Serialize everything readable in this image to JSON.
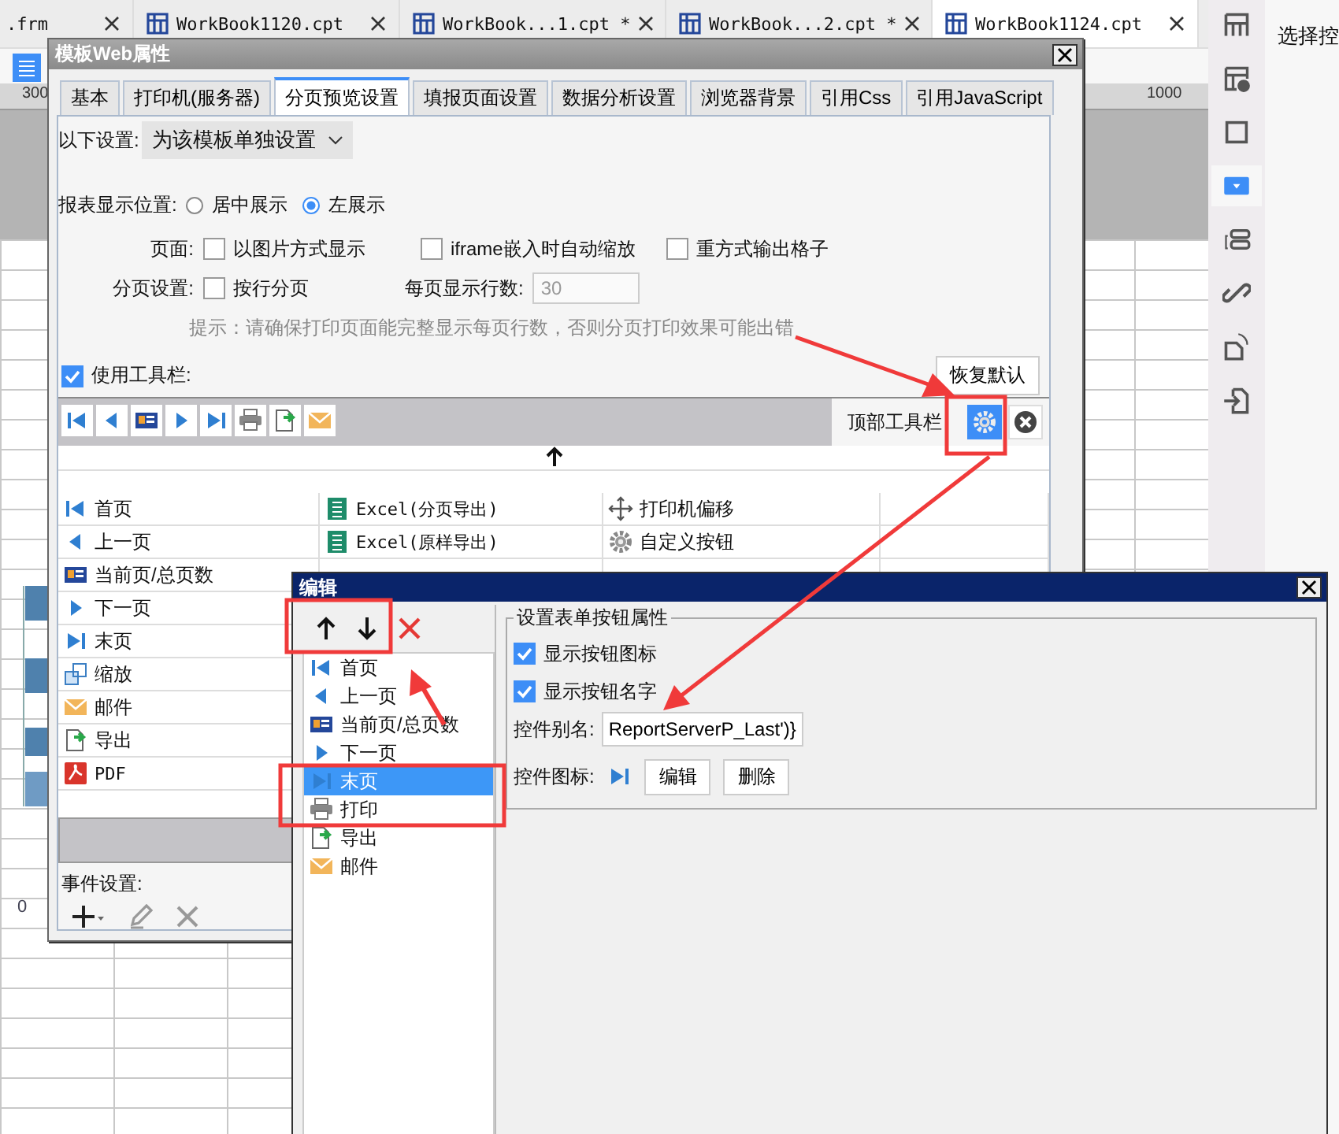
{
  "file_tabs": [
    {
      "label": ".frm",
      "selected": false
    },
    {
      "label": "WorkBook1120.cpt",
      "selected": false
    },
    {
      "label": "WorkBook...1.cpt *",
      "selected": false
    },
    {
      "label": "WorkBook...2.cpt *",
      "selected": false
    },
    {
      "label": "WorkBook1124.cpt",
      "selected": true
    }
  ],
  "ruler": {
    "labels": [
      "300",
      "1000"
    ]
  },
  "chart_axis_label": "0",
  "side_toolbar": [
    {
      "kind": "layout",
      "selected": false
    },
    {
      "kind": "info",
      "selected": false
    },
    {
      "kind": "frame",
      "selected": false
    },
    {
      "kind": "dropdown",
      "selected": true
    },
    {
      "kind": "tag",
      "selected": false
    },
    {
      "kind": "link",
      "selected": false
    },
    {
      "kind": "rotate",
      "selected": false
    },
    {
      "kind": "import",
      "selected": false
    }
  ],
  "right_panel": {
    "text": "选择控"
  },
  "web_dialog": {
    "title": "模板Web属性",
    "tabs": [
      {
        "label": "基本",
        "selected": false
      },
      {
        "label": "打印机(服务器)",
        "selected": false
      },
      {
        "label": "分页预览设置",
        "selected": true
      },
      {
        "label": "填报页面设置",
        "selected": false
      },
      {
        "label": "数据分析设置",
        "selected": false
      },
      {
        "label": "浏览器背景",
        "selected": false
      },
      {
        "label": "引用Css",
        "selected": false
      },
      {
        "label": "引用JavaScript",
        "selected": false
      }
    ],
    "scope": {
      "label": "以下设置:",
      "value": "为该模板单独设置"
    },
    "display_position": {
      "label": "报表显示位置:",
      "options": [
        {
          "label": "居中展示",
          "selected": false
        },
        {
          "label": "左展示",
          "selected": true
        }
      ]
    },
    "page": {
      "label": "页面:",
      "options": [
        {
          "label": "以图片方式显示",
          "checked": false
        },
        {
          "label": "iframe嵌入时自动缩放",
          "checked": false
        },
        {
          "label": "重方式输出格子",
          "checked": false
        }
      ]
    },
    "pagination": {
      "label": "分页设置:",
      "by_row": {
        "label": "按行分页",
        "checked": false
      },
      "rows_label": "每页显示行数:",
      "rows_value": "30"
    },
    "hint": "提示：请确保打印页面能完整显示每页行数，否则分页打印效果可能出错",
    "use_toolbar": {
      "label": "使用工具栏:",
      "checked": true
    },
    "restore_button": "恢复默认",
    "toolbar_preview": {
      "buttons": [
        {
          "kind": "first"
        },
        {
          "kind": "prev"
        },
        {
          "kind": "pageinfo"
        },
        {
          "kind": "next"
        },
        {
          "kind": "last"
        },
        {
          "kind": "print"
        },
        {
          "kind": "export"
        },
        {
          "kind": "mail"
        }
      ],
      "position_label": "顶部工具栏"
    },
    "button_columns": [
      [
        {
          "label": "首页",
          "kind": "first"
        },
        {
          "label": "上一页",
          "kind": "prev"
        },
        {
          "label": "当前页/总页数",
          "kind": "pageinfo"
        },
        {
          "label": "下一页",
          "kind": "next"
        },
        {
          "label": "末页",
          "kind": "last"
        },
        {
          "label": "缩放",
          "kind": "zoom"
        },
        {
          "label": "邮件",
          "kind": "mail"
        },
        {
          "label": "导出",
          "kind": "export"
        },
        {
          "label": "PDF",
          "kind": "pdf"
        }
      ],
      [
        {
          "label": "Excel(分页导出)",
          "kind": "excel"
        },
        {
          "label": "Excel(原样导出)",
          "kind": "excel"
        }
      ],
      [
        {
          "label": "打印机偏移",
          "kind": "move"
        },
        {
          "label": "自定义按钮",
          "kind": "gear"
        }
      ]
    ],
    "event_settings": "事件设置:"
  },
  "edit_dialog": {
    "title": "编辑",
    "items": [
      {
        "label": "首页",
        "kind": "first",
        "selected": false
      },
      {
        "label": "上一页",
        "kind": "prev",
        "selected": false
      },
      {
        "label": "当前页/总页数",
        "kind": "pageinfo",
        "selected": false
      },
      {
        "label": "下一页",
        "kind": "next",
        "selected": false
      },
      {
        "label": "末页",
        "kind": "last",
        "selected": true
      },
      {
        "label": "打印",
        "kind": "print",
        "selected": false
      },
      {
        "label": "导出",
        "kind": "export",
        "selected": false
      },
      {
        "label": "邮件",
        "kind": "mail",
        "selected": false
      }
    ],
    "group_title": "设置表单按钮属性",
    "checkboxes": [
      {
        "label": "显示按钮图标",
        "checked": true
      },
      {
        "label": "显示按钮名字",
        "checked": true
      }
    ],
    "alias": {
      "label": "控件别名:",
      "value": "ReportServerP_Last')}"
    },
    "icon_row": {
      "label": "控件图标:",
      "kind": "last",
      "buttons": [
        "编辑",
        "删除"
      ]
    }
  }
}
